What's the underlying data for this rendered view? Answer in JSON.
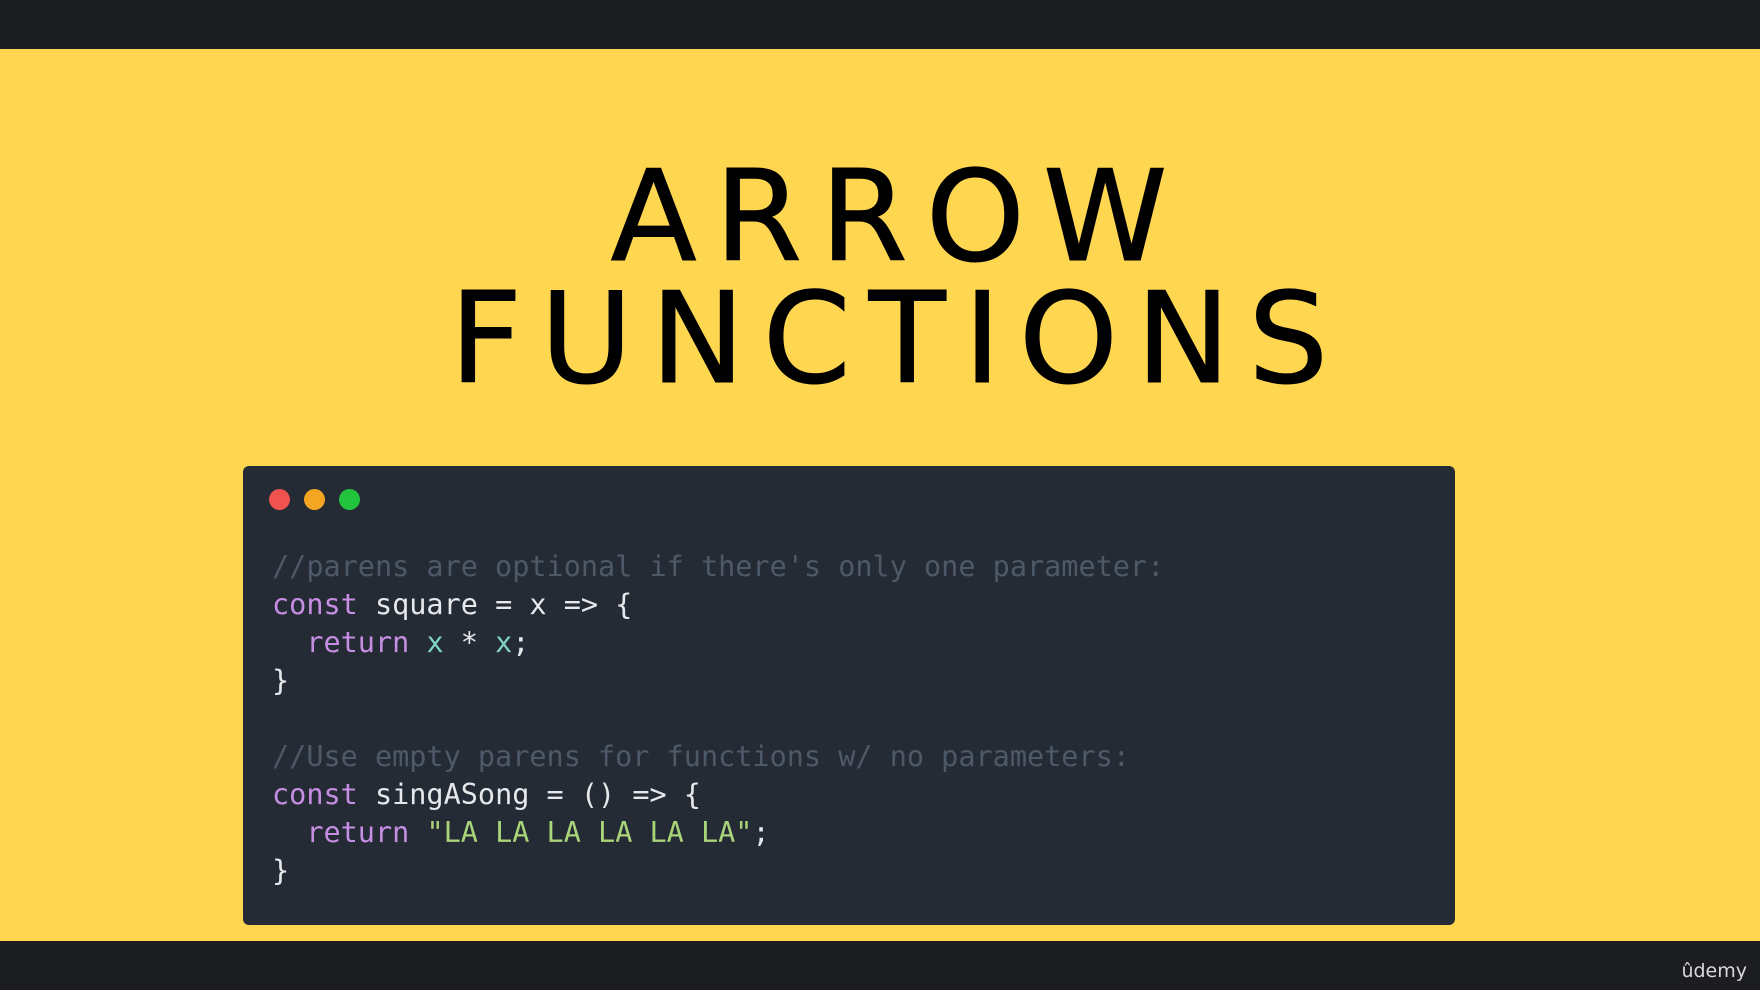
{
  "slide": {
    "title_line_1": "ARROW",
    "title_line_2": "FUNCTIONS",
    "background_color": "#fed650",
    "letterbox_color": "#1b1d20"
  },
  "code_window": {
    "background_color": "#252b35",
    "window_controls": [
      {
        "name": "close",
        "color": "#f0524f"
      },
      {
        "name": "minimize",
        "color": "#f4a521"
      },
      {
        "name": "maximize",
        "color": "#22c33c"
      }
    ],
    "lines": [
      [
        {
          "type": "comment",
          "text": "//parens are optional if there's only one parameter:"
        }
      ],
      [
        {
          "type": "keyword",
          "text": "const"
        },
        {
          "type": "plain",
          "text": " square = x => {"
        }
      ],
      [
        {
          "type": "plain",
          "text": "  "
        },
        {
          "type": "keyword",
          "text": "return"
        },
        {
          "type": "plain",
          "text": " "
        },
        {
          "type": "var",
          "text": "x"
        },
        {
          "type": "plain",
          "text": " * "
        },
        {
          "type": "var",
          "text": "x"
        },
        {
          "type": "plain",
          "text": ";"
        }
      ],
      [
        {
          "type": "plain",
          "text": "}"
        }
      ],
      [
        {
          "type": "plain",
          "text": ""
        }
      ],
      [
        {
          "type": "comment",
          "text": "//Use empty parens for functions w/ no parameters:"
        }
      ],
      [
        {
          "type": "keyword",
          "text": "const"
        },
        {
          "type": "plain",
          "text": " singASong = () => {"
        }
      ],
      [
        {
          "type": "plain",
          "text": "  "
        },
        {
          "type": "keyword",
          "text": "return"
        },
        {
          "type": "plain",
          "text": " "
        },
        {
          "type": "string",
          "text": "\"LA LA LA LA LA LA\""
        },
        {
          "type": "plain",
          "text": ";"
        }
      ],
      [
        {
          "type": "plain",
          "text": "}"
        }
      ]
    ]
  },
  "brand": {
    "label": "ûdemy"
  }
}
